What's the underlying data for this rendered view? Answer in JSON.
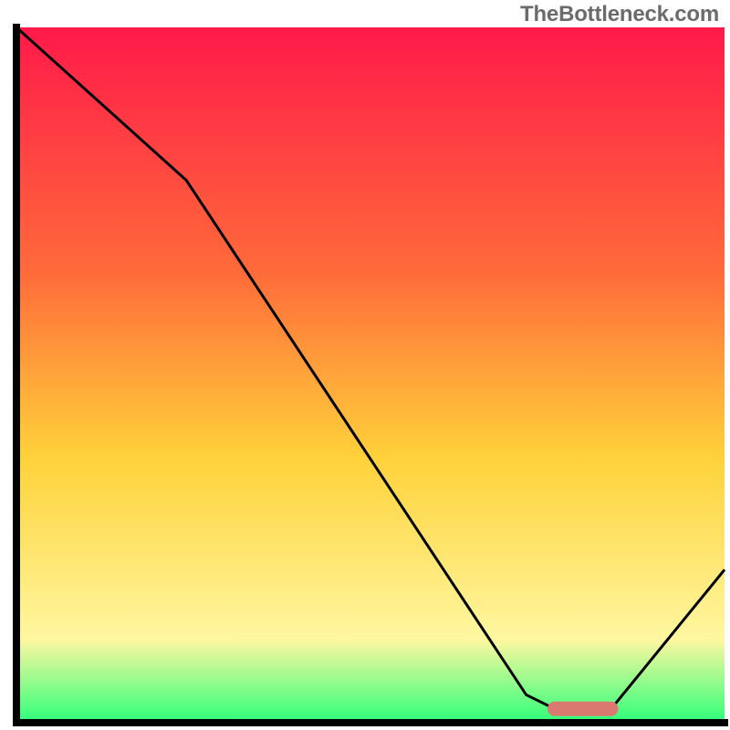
{
  "attribution": "TheBottleneck.com",
  "colors": {
    "axis": "#000000",
    "curve": "#000000",
    "marker_fill": "#d9796f",
    "gradient_top": "#ff1a4a",
    "gradient_mid_upper": "#ff6a3a",
    "gradient_mid": "#ffd23a",
    "gradient_lower": "#fff7a0",
    "gradient_bottom": "#2dff7a"
  },
  "chart_data": {
    "type": "line",
    "title": "",
    "xlabel": "",
    "ylabel": "",
    "x_range": [
      0,
      100
    ],
    "y_range": [
      0,
      100
    ],
    "curve": [
      {
        "x": 0,
        "y": 100
      },
      {
        "x": 24,
        "y": 78
      },
      {
        "x": 72,
        "y": 4
      },
      {
        "x": 76,
        "y": 2
      },
      {
        "x": 84,
        "y": 2
      },
      {
        "x": 100,
        "y": 22
      }
    ],
    "marker": {
      "x_start": 75,
      "x_end": 85,
      "y": 2
    }
  }
}
